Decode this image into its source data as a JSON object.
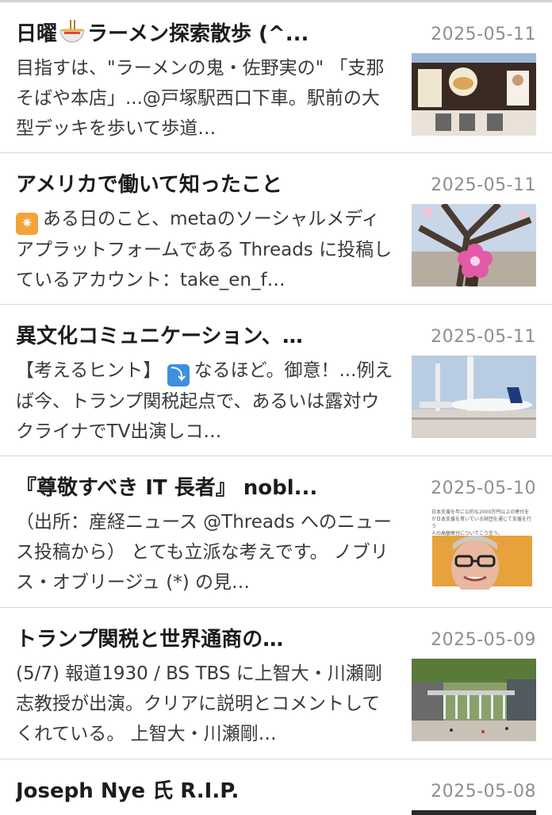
{
  "articles": [
    {
      "title": "日曜 ラーメン探索散歩 (^...",
      "title_pre": "日曜",
      "title_post": "ラーメン探索散歩 (^...",
      "date": "2025-05-11",
      "excerpt": "目指すは、\"ラーメンの鬼・佐野実の\" 「支那そばや本店」...@戸塚駅西口下車。駅前の大型デッキを歩いて歩道…",
      "thumb_icon": "ramen-shop-photo"
    },
    {
      "title": "アメリカで働いて知ったこと",
      "date": "2025-05-11",
      "excerpt": "ある日のこと、metaのソーシャルメディアプラットフォームである Threads に投稿しているアカウント：take_en_f…",
      "thumb_icon": "cherry-tree-photo"
    },
    {
      "title": "異文化コミュニケーション、…",
      "date": "2025-05-11",
      "excerpt": "【考えるヒント】 なるほど。御意！...例えば今、トランプ関税起点で、あるいは露対ウクライナでTV出演しコ…",
      "excerpt_pre": "【考えるヒント】",
      "excerpt_post": "なるほど。御意！...例えば今、トランプ関税起点で、あるいは露対ウクライナでTV出演しコ…",
      "thumb_icon": "airport-photo"
    },
    {
      "title": "『尊敬すべき IT 長者』 nobl...",
      "date": "2025-05-10",
      "excerpt": "（出所：産経ニュース @Threads へのニュース投稿から） とても立派な考えです。 ノブリス・オブリージュ (*) の見…",
      "thumb_icon": "news-portrait-photo"
    },
    {
      "title": "トランプ関税と世界通商の…",
      "date": "2025-05-09",
      "excerpt": "(5/7) 報道1930 / BS TBS に上智大・川瀬剛志教授が出演。クリアに説明とコメントしてくれている。 上智大・川瀬剛…",
      "thumb_icon": "plaza-fountain-photo"
    },
    {
      "title": "Joseph Nye 氏 R.I.P.",
      "date": "2025-05-08",
      "excerpt": "",
      "thumb_icon": ""
    }
  ],
  "thumb_text": {
    "line1": "日本支援を年に公的な2000万円以上の寄付を",
    "line2": "が日本支援を貫いている財団を通じて支援を行う",
    "line3": "人の高額寄付についてこう言う。"
  }
}
